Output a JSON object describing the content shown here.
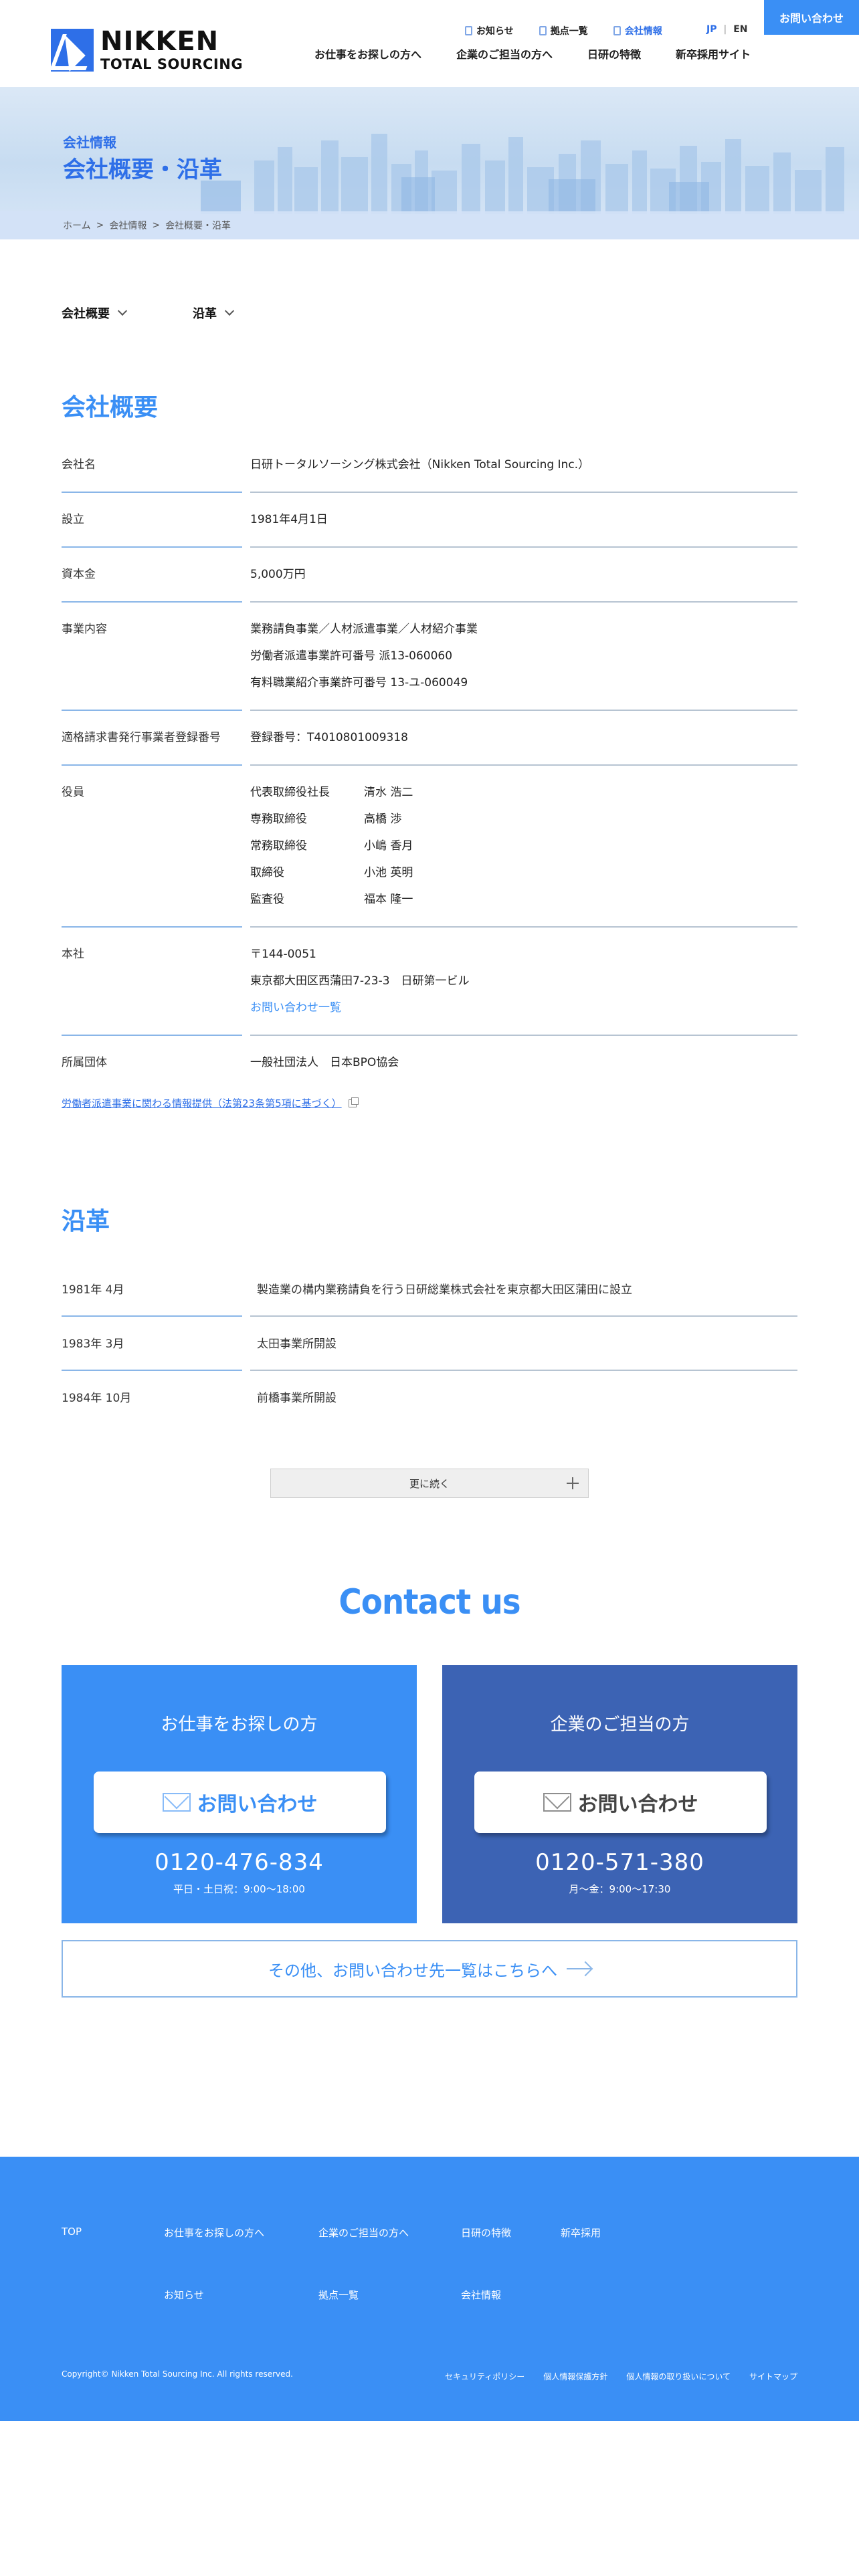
{
  "header": {
    "logo_line1": "NIKKEN",
    "logo_line2": "TOTAL SOURCING",
    "util_links": [
      {
        "label": "お知らせ"
      },
      {
        "label": "拠点一覧"
      },
      {
        "label": "会社情報"
      }
    ],
    "lang_jp": "JP",
    "lang_sep": "|",
    "lang_en": "EN",
    "contact_button": "お問い合わせ",
    "nav": [
      {
        "label": "お仕事をお探しの方へ"
      },
      {
        "label": "企業のご担当の方へ"
      },
      {
        "label": "日研の特徴"
      },
      {
        "label": "新卒採用サイト"
      }
    ]
  },
  "hero": {
    "subtitle": "会社情報",
    "title": "会社概要・沿革",
    "breadcrumb": [
      "ホーム",
      "会社情報",
      "会社概要・沿革"
    ],
    "breadcrumb_sep": ">"
  },
  "anchors": [
    {
      "label": "会社概要"
    },
    {
      "label": "沿革"
    }
  ],
  "overview": {
    "title": "会社概要",
    "company_name_label": "会社名",
    "company_name": "日研トータルソーシング株式会社（Nikken Total Sourcing Inc.）",
    "established_label": "設立",
    "established": "1981年4月1日",
    "capital_label": "資本金",
    "capital": "5,000万円",
    "business_label": "事業内容",
    "business": [
      "業務請負事業／人材派遣事業／人材紹介事業",
      "労働者派遣事業許可番号 派13-060060",
      "有料職業紹介事業許可番号 13-ユ-060049"
    ],
    "invoice_label": "適格請求書発行事業者登録番号",
    "invoice": "登録番号：T4010801009318",
    "officers_label": "役員",
    "officers": [
      {
        "role": "代表取締役社長",
        "name": "清水 浩二"
      },
      {
        "role": "専務取締役",
        "name": "高橋 渉"
      },
      {
        "role": "常務取締役",
        "name": "小嶋 香月"
      },
      {
        "role": "取締役",
        "name": "小池 英明"
      },
      {
        "role": "監査役",
        "name": "福本 隆一"
      }
    ],
    "hq_label": "本社",
    "hq_postal": "〒144-0051",
    "hq_address": "東京都大田区西蒲田7-23-3　日研第一ビル",
    "hq_link": "お問い合わせ一覧",
    "association_label": "所属団体",
    "association": "一般社団法人　日本BPO協会",
    "info_link": "労働者派遣事業に関わる情報提供（法第23条第5項に基づく）"
  },
  "history": {
    "title": "沿革",
    "rows": [
      {
        "date": "1981年 4月",
        "event": "製造業の構内業務請負を行う日研総業株式会社を東京都大田区蒲田に設立"
      },
      {
        "date": "1983年 3月",
        "event": "太田事業所開設"
      },
      {
        "date": "1984年 10月",
        "event": "前橋事業所開設"
      }
    ],
    "more_button": "更に続く"
  },
  "contact": {
    "title": "Contact us",
    "left": {
      "title": "お仕事をお探しの方",
      "button": "お問い合わせ",
      "phone": "0120-476-834",
      "hours": "平日・土日祝：9:00〜18:00"
    },
    "right": {
      "title": "企業のご担当の方",
      "button": "お問い合わせ",
      "phone": "0120-571-380",
      "hours": "月〜金：9:00〜17:30"
    },
    "other_button": "その他、お問い合わせ先一覧はこちらへ"
  },
  "footer": {
    "nav_row1": [
      "TOP",
      "お仕事をお探しの方へ",
      "企業のご担当の方へ",
      "日研の特徴",
      "新卒採用"
    ],
    "nav_row2": [
      "お知らせ",
      "拠点一覧",
      "会社情報"
    ],
    "copyright": "Copyright© Nikken Total Sourcing Inc. All rights reserved.",
    "links": [
      "セキュリティポリシー",
      "個人情報保護方針",
      "個人情報の取り扱いについて",
      "サイトマップ"
    ]
  },
  "colors": {
    "brand_blue": "#3a8ff5",
    "dark_blue": "#3c63b4",
    "logo_blue": "#2e6fe8"
  }
}
